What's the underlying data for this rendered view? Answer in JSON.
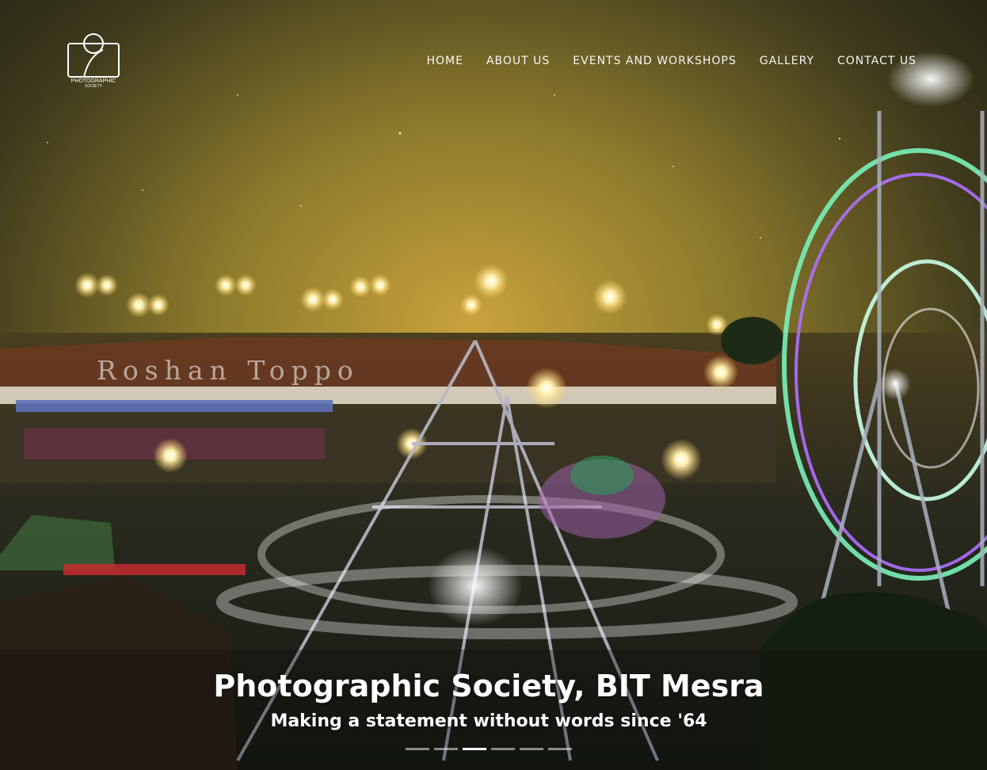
{
  "brand": {
    "logo_line1": "PHOTOGRAPHIC",
    "logo_line2": "SOCIETY"
  },
  "nav": {
    "items": [
      {
        "label": "HOME"
      },
      {
        "label": "ABOUT US"
      },
      {
        "label": "EVENTS AND WORKSHOPS"
      },
      {
        "label": "GALLERY"
      },
      {
        "label": "CONTACT US"
      }
    ]
  },
  "hero": {
    "watermark": "Roshan Toppo",
    "title": "Photographic Society, BIT Mesra",
    "subtitle": "Making a statement without words since '64",
    "slide_count": 6,
    "active_slide": 3
  },
  "colors": {
    "sky_top": "#1f1d12",
    "glow": "#c8a23a",
    "ring_green": "#7af0b8",
    "ring_purple": "#b070ff"
  }
}
